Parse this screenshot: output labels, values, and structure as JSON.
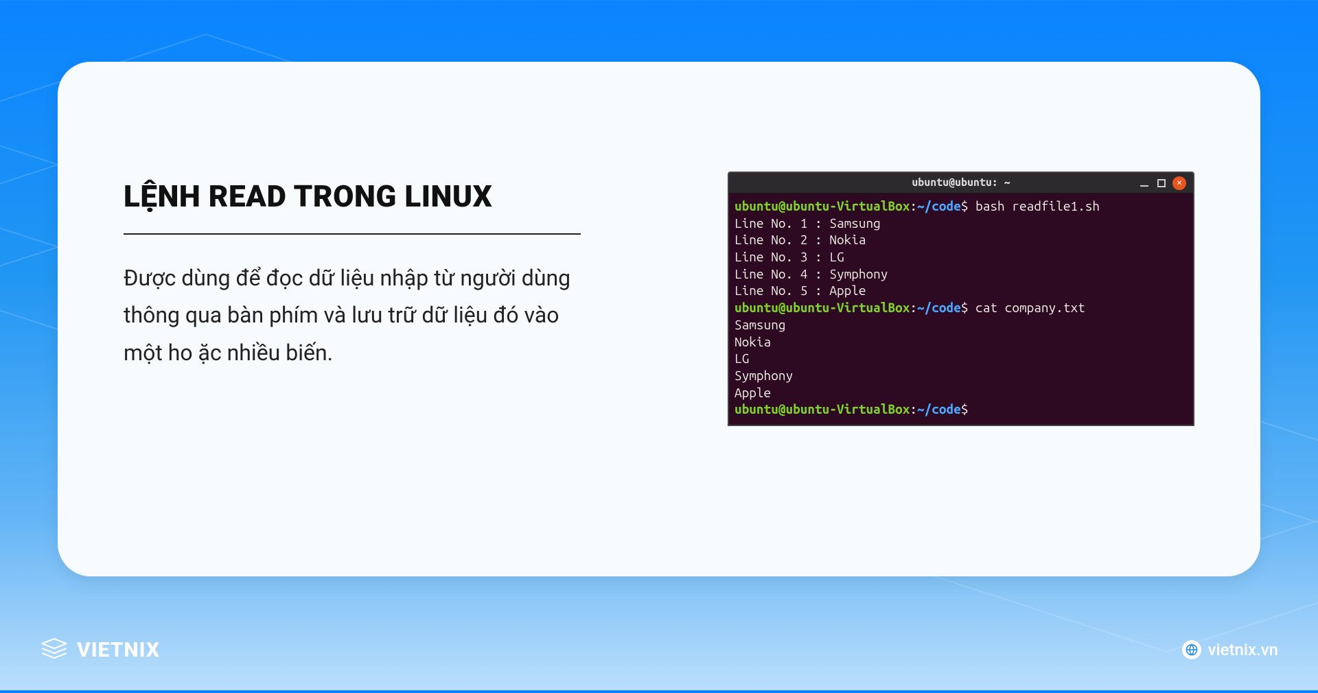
{
  "card": {
    "title": "LỆNH READ TRONG LINUX",
    "description": "Được dùng để đọc dữ liệu nhập từ người dùng thông qua bàn phím và lưu trữ dữ liệu đó vào một ho ặc  nhiều biến."
  },
  "terminal": {
    "window_title": "ubuntu@ubuntu: ~",
    "prompts": [
      {
        "user": "ubuntu@ubuntu-VirtualBox",
        "sep": ":",
        "path": "~/code",
        "dollar": "$ ",
        "cmd": "bash readfile1.sh"
      },
      {
        "user": "ubuntu@ubuntu-VirtualBox",
        "sep": ":",
        "path": "~/code",
        "dollar": "$ ",
        "cmd": "cat company.txt"
      },
      {
        "user": "ubuntu@ubuntu-VirtualBox",
        "sep": ":",
        "path": "~/code",
        "dollar": "$ ",
        "cmd": ""
      }
    ],
    "output1": [
      "Line No. 1 : Samsung",
      "Line No. 2 : Nokia",
      "Line No. 3 : LG",
      "Line No. 4 : Symphony",
      "Line No. 5 : Apple"
    ],
    "output2": [
      "Samsung",
      "Nokia",
      "LG",
      "Symphony",
      "Apple"
    ]
  },
  "footer": {
    "brand": "VIETNIX",
    "site": "vietnix.vn"
  }
}
